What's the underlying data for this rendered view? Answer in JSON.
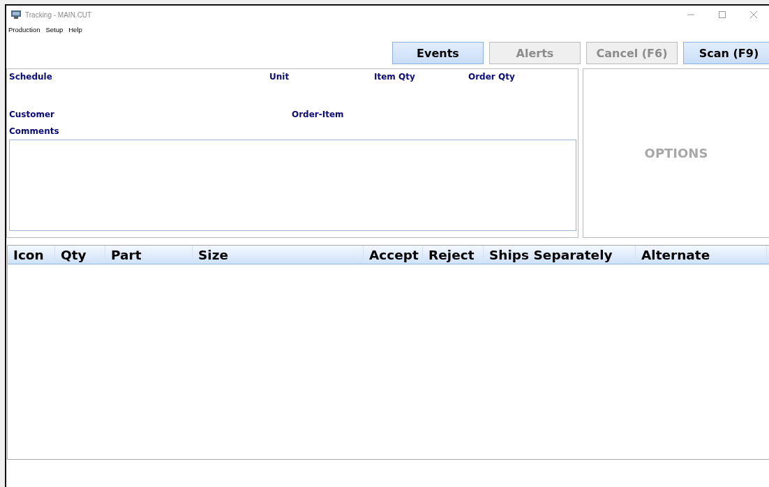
{
  "window": {
    "title": "Tracking - MAIN.CUT"
  },
  "menu": [
    "Production",
    "Setup",
    "Help"
  ],
  "buttons": [
    {
      "label": "Events",
      "disabled": false
    },
    {
      "label": "Alerts",
      "disabled": true
    },
    {
      "label": "Cancel (F6)",
      "disabled": true
    },
    {
      "label": "Scan (F9)",
      "disabled": false
    }
  ],
  "info": {
    "row_1": [
      "Schedule",
      "Unit",
      "Item Qty",
      "Order Qty"
    ],
    "row_2": [
      "Customer",
      "Order-Item"
    ],
    "comments_label": "Comments"
  },
  "options": {
    "label": "OPTIONS"
  },
  "table": {
    "columns": [
      "Icon",
      "Qty",
      "Part",
      "Size",
      "Accept",
      "Reject",
      "Ships Separately",
      "Alternate"
    ]
  }
}
